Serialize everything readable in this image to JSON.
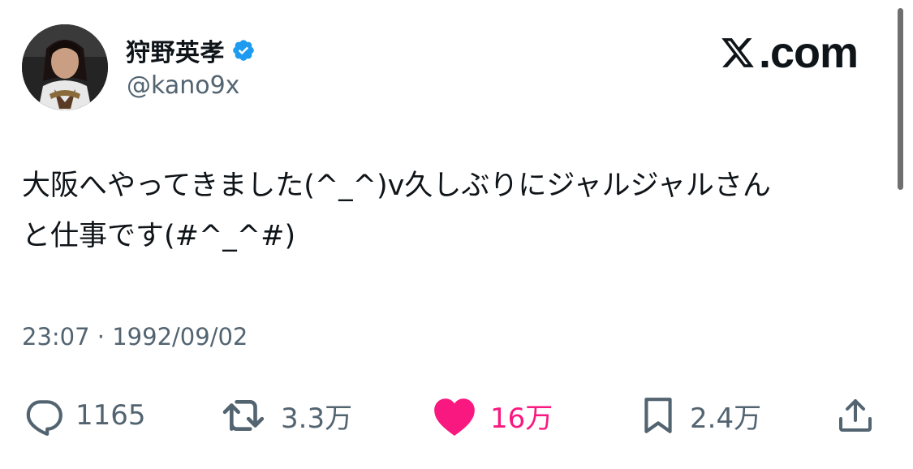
{
  "user": {
    "display_name": "狩野英孝",
    "handle": "@kano9x",
    "verified": true,
    "avatar_icon": "profile-photo"
  },
  "brand": {
    "text": ".com",
    "logo_icon": "x-logo-icon"
  },
  "tweet": {
    "text": "大阪へやってきました(^_^)v久しぶりにジャルジャルさん\nと仕事です(#^_^#)",
    "timestamp": "23:07 · 1992/09/02"
  },
  "actions": {
    "reply": {
      "icon": "reply-icon",
      "count": "1165"
    },
    "retweet": {
      "icon": "retweet-icon",
      "count": "3.3万"
    },
    "like": {
      "icon": "heart-icon",
      "count": "16万",
      "active": true
    },
    "bookmark": {
      "icon": "bookmark-icon",
      "count": "2.4万"
    },
    "share": {
      "icon": "share-icon"
    }
  },
  "colors": {
    "text_primary": "#0f1419",
    "text_secondary": "#536471",
    "verified_blue": "#1d9bf0",
    "like_pink": "#f91880"
  }
}
